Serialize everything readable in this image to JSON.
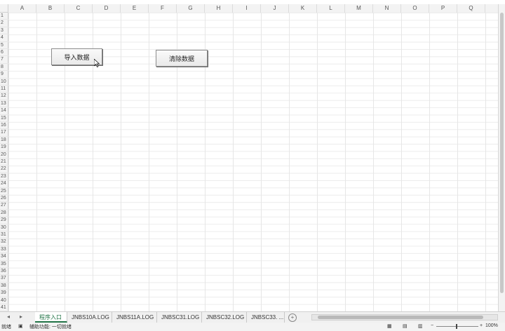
{
  "columns": [
    "A",
    "B",
    "C",
    "D",
    "E",
    "F",
    "G",
    "H",
    "I",
    "J",
    "K",
    "L",
    "M",
    "N",
    "O",
    "P",
    "Q"
  ],
  "rows": [
    "1",
    "2",
    "3",
    "4",
    "5",
    "6",
    "7",
    "8",
    "9",
    "10",
    "11",
    "12",
    "13",
    "14",
    "15",
    "16",
    "17",
    "18",
    "19",
    "20",
    "21",
    "22",
    "23",
    "24",
    "25",
    "26",
    "27",
    "28",
    "29",
    "30",
    "31",
    "32",
    "33",
    "34",
    "35",
    "36",
    "37",
    "38",
    "39",
    "40",
    "41"
  ],
  "buttons": {
    "import": "导入数据",
    "clear": "清除数据"
  },
  "tabs": [
    "程序入口",
    "JNBS10A.LOG",
    "JNBS11A.LOG",
    "JNBSC31.LOG",
    "JNBSC32.LOG",
    "JNBSC33. ..."
  ],
  "active_tab": "程序入口",
  "nav": {
    "prev": "◂",
    "next": "▸",
    "add": "+"
  },
  "status": {
    "ready": "就绪",
    "accessibility": "辅助功能: 一切就绪",
    "zoom": "100%"
  },
  "colors": {
    "accent": "#217346"
  }
}
